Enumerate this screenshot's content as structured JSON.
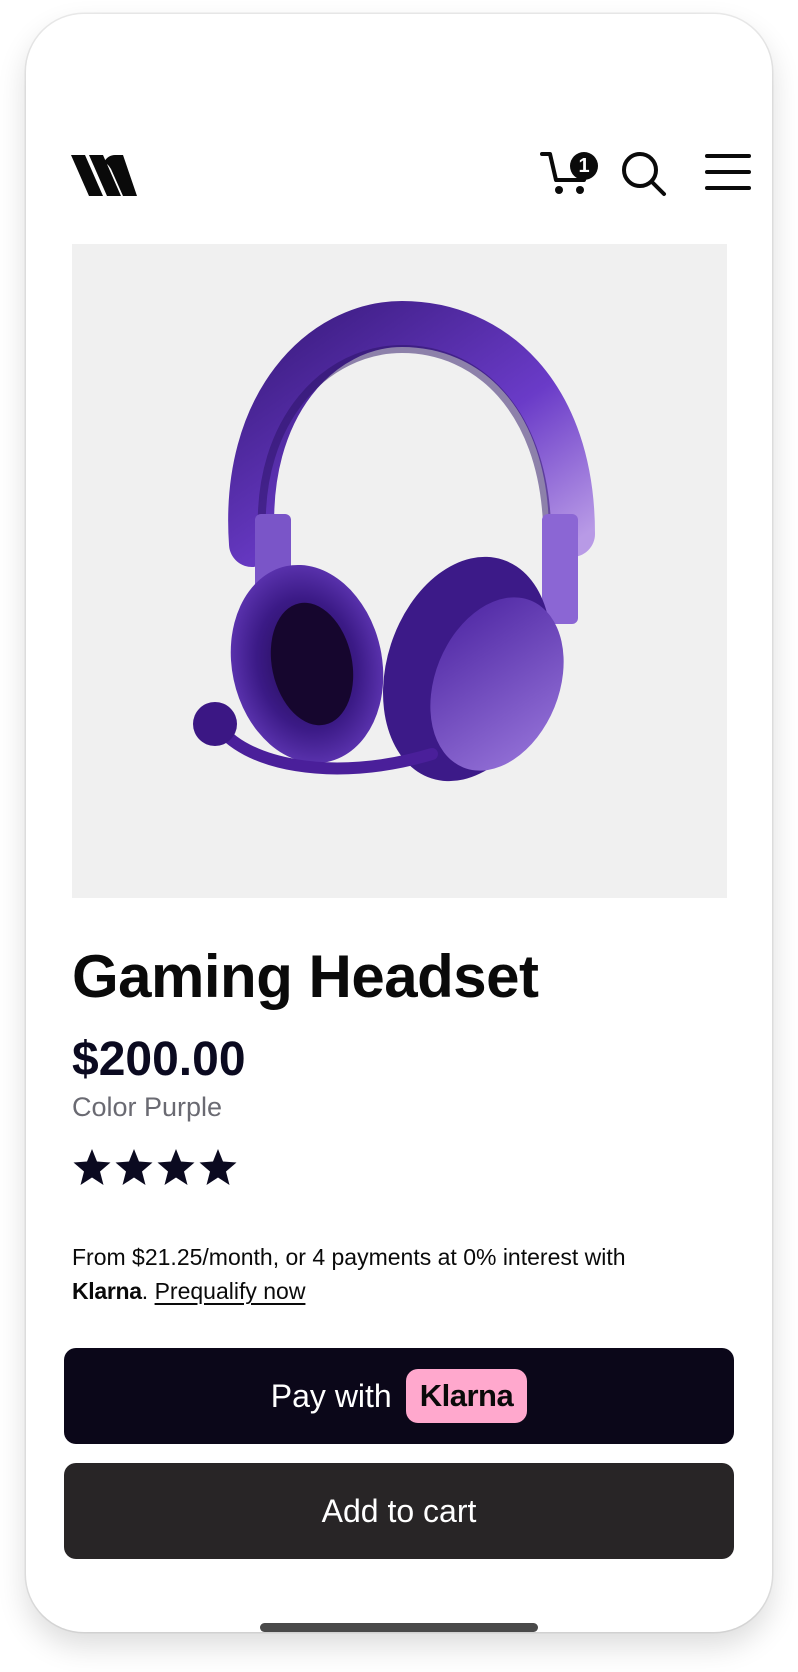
{
  "header": {
    "logo": "brand-logo",
    "cart_count": "1",
    "icons": [
      "cart-icon",
      "search-icon",
      "hamburger-menu-icon"
    ]
  },
  "product": {
    "image": "purple-gaming-headset-photo",
    "title": "Gaming Headset",
    "price": "$200.00",
    "color_label": "Color",
    "color_value": "Purple",
    "color_text": "Color Purple",
    "rating_stars": 4
  },
  "financing": {
    "text": "From $21.25/month, or 4 payments at 0% interest with",
    "provider": "Klarna",
    "link_label": "Prequalify now"
  },
  "buttons": {
    "pay_with_label": "Pay with",
    "klarna_badge": "Klarna",
    "add_to_cart": "Add to cart"
  },
  "colors": {
    "pay_button": "#0b0719",
    "add_to_cart_button": "#282526",
    "klarna_pink": "#ffa8cd",
    "product_bg": "#f0f0f0",
    "headset_purple": "#5b2bb0"
  }
}
